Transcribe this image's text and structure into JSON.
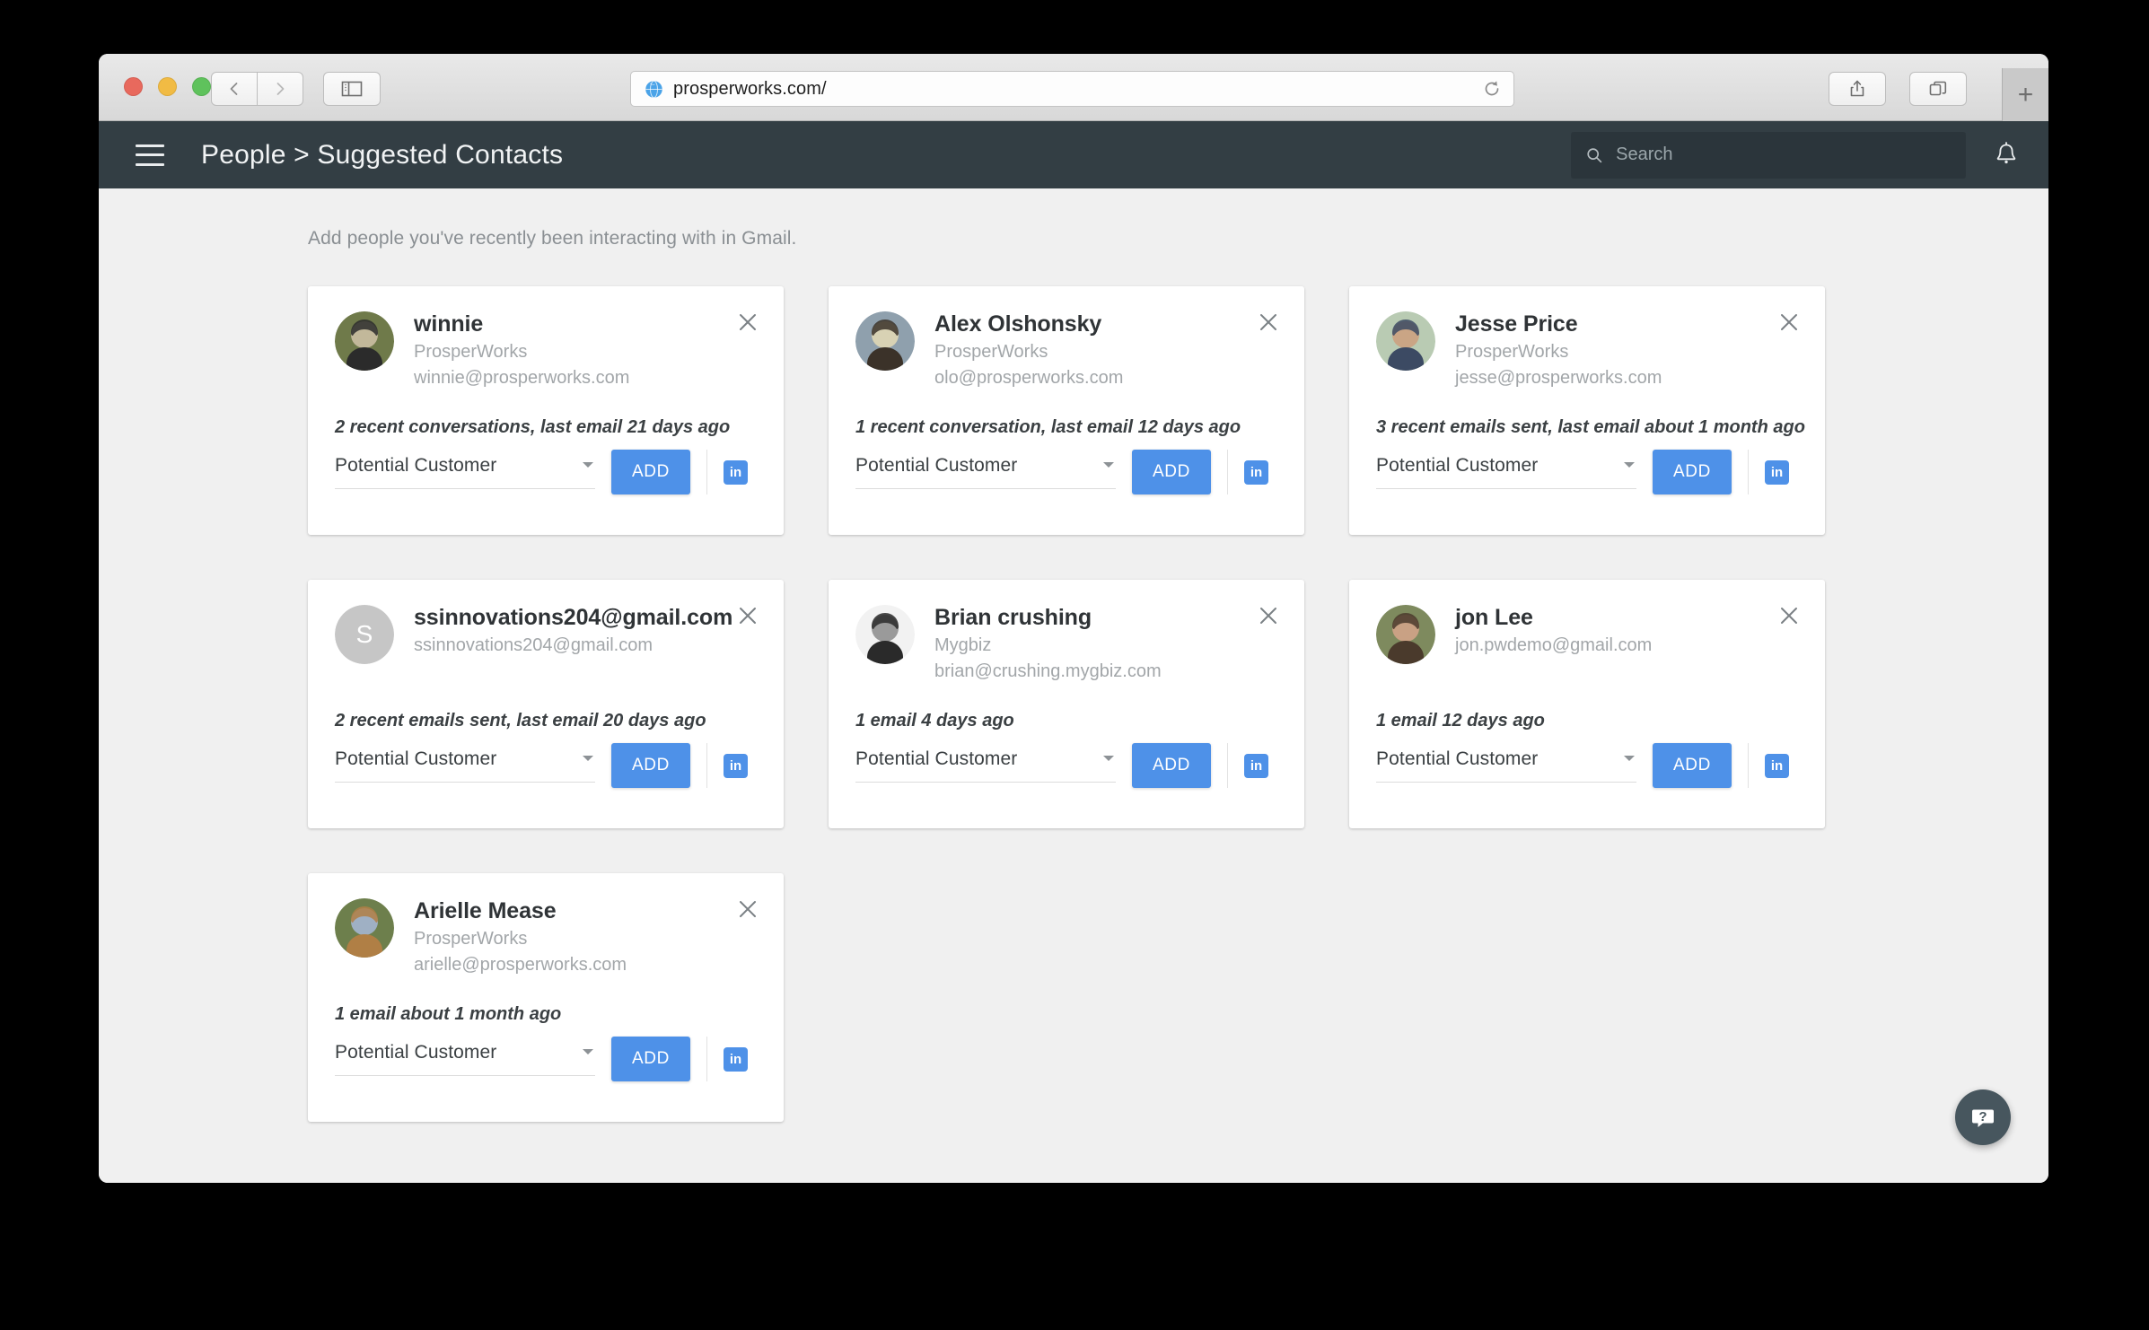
{
  "browser": {
    "url": "prosperworks.com/",
    "back_label": "Back",
    "forward_label": "Forward",
    "sidebar_label": "Show Sidebar",
    "reload_label": "Reload",
    "share_label": "Share",
    "tabs_label": "Show Tab Overview",
    "new_tab_label": "+"
  },
  "header": {
    "menu_label": "Menu",
    "breadcrumb": "People > Suggested Contacts",
    "search": {
      "value": "",
      "placeholder": "Search"
    },
    "notifications_label": "Notifications"
  },
  "page": {
    "subtitle": "Add people you've recently been interacting with in Gmail.",
    "help_label": "?"
  },
  "labels": {
    "add_button": "ADD",
    "linkedin": "in",
    "close": "Close"
  },
  "colors": {
    "accent_blue": "#4e91e8",
    "header_dark": "#333e44",
    "page_bg": "#f0f0f0",
    "card_bg": "#ffffff",
    "muted_text": "#a2a6a9",
    "help_bg": "#47565e"
  },
  "cards": [
    {
      "name": "winnie",
      "company": "ProsperWorks",
      "email": "winnie@prosperworks.com",
      "activity": "2 recent conversations, last email 21 days ago",
      "relationship": "Potential Customer",
      "avatar_type": "photo",
      "avatar_initial": "",
      "avatar_colors": [
        "#6f7a4a",
        "#2b2b2b",
        "#c2b89a"
      ]
    },
    {
      "name": "Alex Olshonsky",
      "company": "ProsperWorks",
      "email": "olo@prosperworks.com",
      "activity": "1 recent conversation, last email 12 days ago",
      "relationship": "Potential Customer",
      "avatar_type": "photo",
      "avatar_initial": "",
      "avatar_colors": [
        "#8fa0ad",
        "#3b3229",
        "#d8d2b4"
      ]
    },
    {
      "name": "Jesse Price",
      "company": "ProsperWorks",
      "email": "jesse@prosperworks.com",
      "activity": "3 recent emails sent, last email about 1 month ago",
      "relationship": "Potential Customer",
      "avatar_type": "photo",
      "avatar_initial": "",
      "avatar_colors": [
        "#b9cbb3",
        "#3c4a63",
        "#caa585"
      ]
    },
    {
      "name": "ssinnovations204@gmail.com",
      "company": "",
      "email": "ssinnovations204@gmail.com",
      "activity": "2 recent emails sent, last email 20 days ago",
      "relationship": "Potential Customer",
      "avatar_type": "initial",
      "avatar_initial": "S",
      "avatar_colors": []
    },
    {
      "name": "Brian crushing",
      "company": "Mygbiz",
      "email": "brian@crushing.mygbiz.com",
      "activity": "1 email 4 days ago",
      "relationship": "Potential Customer",
      "avatar_type": "photo",
      "avatar_initial": "",
      "avatar_colors": [
        "#f2f2f2",
        "#2a2a2a",
        "#9a9a9a"
      ]
    },
    {
      "name": "jon Lee",
      "company": "",
      "email": "jon.pwdemo@gmail.com",
      "activity": "1 email 12 days ago",
      "relationship": "Potential Customer",
      "avatar_type": "photo",
      "avatar_initial": "",
      "avatar_colors": [
        "#7e8a5e",
        "#4a3a2c",
        "#c9a184"
      ]
    },
    {
      "name": "Arielle Mease",
      "company": "ProsperWorks",
      "email": "arielle@prosperworks.com",
      "activity": "1 email about 1 month ago",
      "relationship": "Potential Customer",
      "avatar_type": "photo",
      "avatar_initial": "",
      "avatar_colors": [
        "#6d7f4c",
        "#b07f45",
        "#9fb0c4"
      ]
    }
  ]
}
